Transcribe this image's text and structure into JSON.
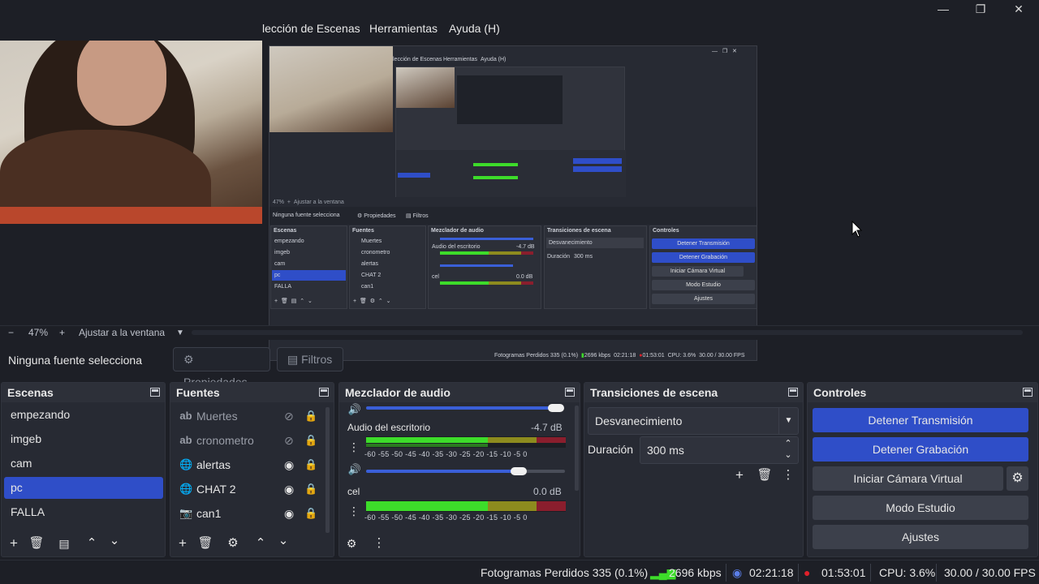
{
  "window": {
    "minimize": "—",
    "maximize": "❐",
    "close": "✕"
  },
  "menu": {
    "items": [
      "lección de Escenas",
      "Herramientas",
      "Ayuda (H)"
    ]
  },
  "zoom": {
    "minus": "−",
    "level": "47%",
    "plus": "+",
    "fit": "Ajustar a la ventana",
    "dropdown": "▼"
  },
  "source_bar": {
    "label": "Ninguna fuente selecciona",
    "properties": "Propiedades",
    "filters": "Filtros"
  },
  "scenes": {
    "title": "Escenas",
    "items": [
      "empezando",
      "imgeb",
      "cam",
      "pc",
      "FALLA"
    ],
    "selected": "pc"
  },
  "sources": {
    "title": "Fuentes",
    "items": [
      {
        "name": "Muertes",
        "icon": "text-icon",
        "visible": false
      },
      {
        "name": "cronometro",
        "icon": "text-icon",
        "visible": false
      },
      {
        "name": "alertas",
        "icon": "browser-icon",
        "visible": true
      },
      {
        "name": "CHAT 2",
        "icon": "browser-icon",
        "visible": true
      },
      {
        "name": "can1",
        "icon": "camera-icon",
        "visible": true
      }
    ]
  },
  "mixer": {
    "title": "Mezclador de audio",
    "ticks": "-60 -55 -50 -45 -40 -35 -30 -25 -20 -15 -10 -5 0",
    "channels": [
      {
        "name": "Audio del escritorio",
        "level": "-4.7 dB",
        "volume": 0.8
      },
      {
        "name": "cel",
        "level": "0.0 dB",
        "volume": 0.8
      }
    ]
  },
  "transitions": {
    "title": "Transiciones de escena",
    "selected": "Desvanecimiento",
    "duration_label": "Duración",
    "duration_value": "300 ms"
  },
  "controls": {
    "title": "Controles",
    "stop_stream": "Detener Transmisión",
    "stop_recording": "Detener Grabación",
    "virtual_cam": "Iniciar Cámara Virtual",
    "studio_mode": "Modo Estudio",
    "settings": "Ajustes"
  },
  "status": {
    "dropped_frames": "Fotogramas Perdidos 335 (0.1%)",
    "bitrate": "2696 kbps",
    "stream_time": "02:21:18",
    "rec_time": "01:53:01",
    "cpu": "CPU: 3.6%",
    "fps": "30.00 / 30.00 FPS"
  },
  "inner_preview": {
    "menu": [
      "lección de Escenas",
      "Herramientas",
      "Ayuda (H)"
    ],
    "zoom": "47%",
    "fit": "Ajustar a la ventana",
    "no_source": "Ninguna fuente selecciona",
    "properties": "Propiedades",
    "filters": "Filtros",
    "scenes_title": "Escenas",
    "sources_title": "Fuentes",
    "mixer_title": "Mezclador de audio",
    "transitions_title": "Transiciones de escena",
    "controls_title": "Controles",
    "scenes": [
      "empezando",
      "imgeb",
      "cam",
      "pc",
      "FALLA"
    ],
    "sources": [
      "Muertes",
      "cronometro",
      "alertas",
      "CHAT 2",
      "can1"
    ],
    "channels": [
      {
        "name": "Audio del escritorio",
        "level": "-4.7 dB"
      },
      {
        "name": "cel",
        "level": "0.0 dB"
      }
    ],
    "transition": "Desvanecimiento",
    "duration_label": "Duración",
    "duration": "300 ms",
    "buttons": [
      "Detener Transmisión",
      "Detener Grabación",
      "Iniciar Cámara Virtual",
      "Modo Estudio",
      "Ajustes"
    ],
    "status": [
      "Fotogramas Perdidos 335 (0.1%)",
      "2696 kbps",
      "02:21:18",
      "01:53:01",
      "CPU: 3.6%",
      "30.00 / 30.00 FPS"
    ]
  },
  "colors": {
    "accent": "#2f4ec8",
    "meter_green": "#3ddc2a",
    "meter_yellow": "#8d8b1e",
    "meter_red": "#8a1e2d",
    "rec_red": "#e0202a"
  }
}
